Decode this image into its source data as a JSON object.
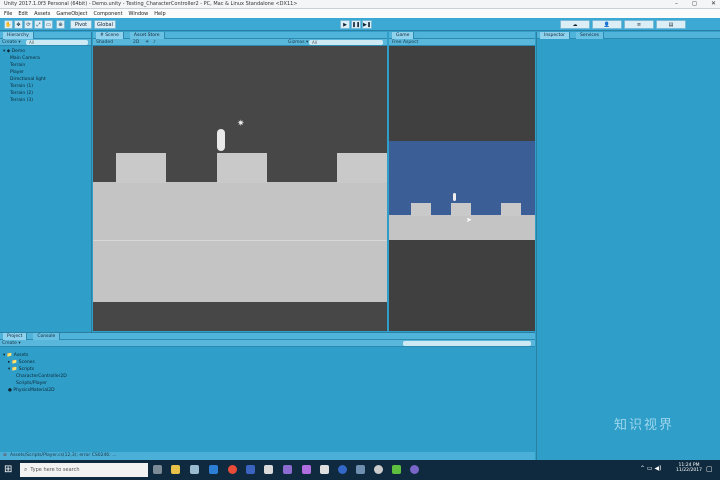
{
  "window": {
    "title": "Unity 2017.1.0f3 Personal (64bit) - Demo.unity - Testing_CharacterController2 - PC, Mac & Linux Standalone <DX11>",
    "controls": [
      "–",
      "◻",
      "✕"
    ]
  },
  "menu": [
    "File",
    "Edit",
    "Assets",
    "GameObject",
    "Component",
    "Window",
    "Help"
  ],
  "toolbar": {
    "pivot": "Pivot",
    "global": "Global"
  },
  "hierarchy": {
    "tab": "Hierarchy",
    "create": "Create ▾",
    "search_placeholder": "All",
    "items": [
      "Demo",
      "Main Camera",
      "Terrain",
      "Player",
      "Directional light",
      "Terrain (1)",
      "Terrain (2)",
      "Terrain (3)"
    ]
  },
  "scene": {
    "tab_scene": "# Scene",
    "tab_asset_store": "Asset Store",
    "shaded": "Shaded",
    "gizmos": "Gizmos ▾",
    "search_placeholder": "All"
  },
  "game": {
    "tab": "Game",
    "display": "Free Aspect"
  },
  "inspector": {
    "tab_inspector": "Inspector",
    "tab_services": "Services"
  },
  "project": {
    "tab_project": "Project",
    "tab_console": "Console",
    "create": "Create ▾",
    "items": [
      "Assets",
      "Scenes",
      "Scripts",
      "CharacterController2D",
      "Scripts/Player",
      "PhysicsMaterial2D"
    ]
  },
  "status": {
    "message": "Assets/Scripts/Player.cs(12,3): error CS0246: ..."
  },
  "taskbar": {
    "search_placeholder": "Type here to search",
    "time": "11:24 PM",
    "date": "11/22/2017"
  },
  "watermark": "知识视界"
}
